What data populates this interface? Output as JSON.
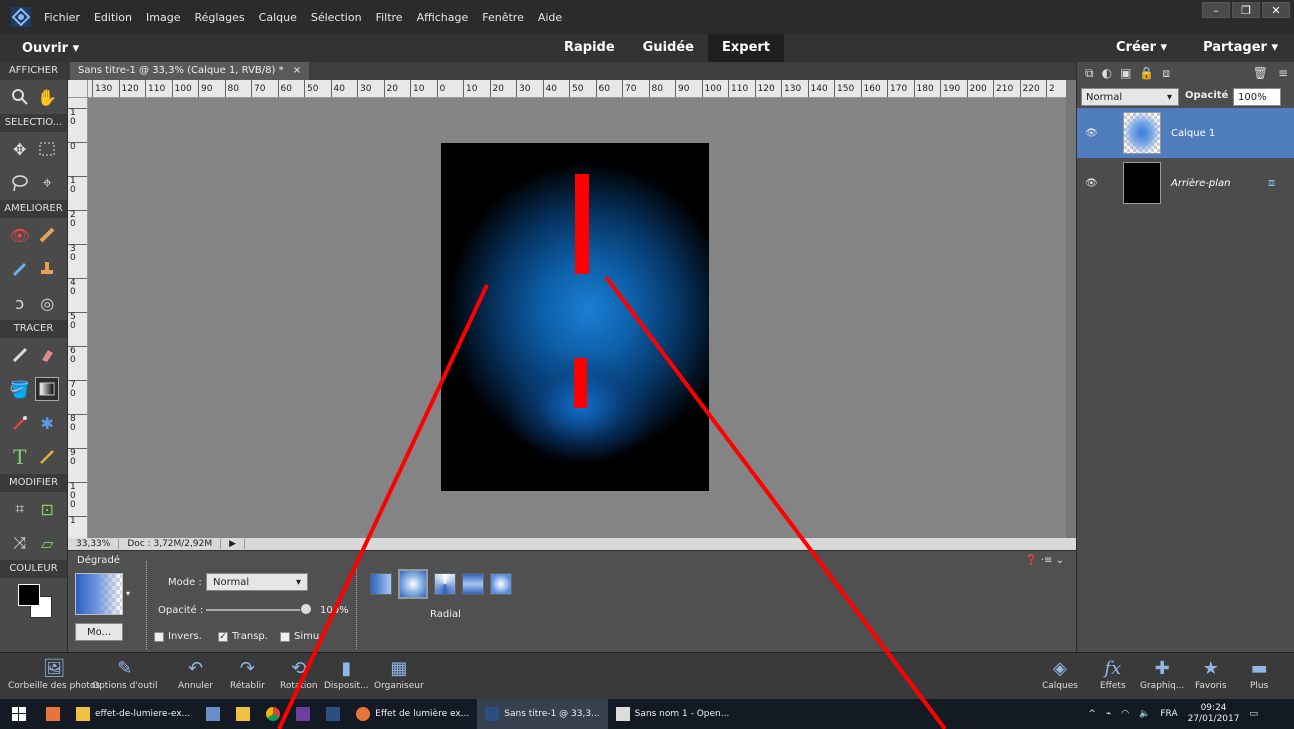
{
  "menu": {
    "items": [
      "Fichier",
      "Edition",
      "Image",
      "Réglages",
      "Calque",
      "Sélection",
      "Filtre",
      "Affichage",
      "Fenêtre",
      "Aide"
    ]
  },
  "window_controls": {
    "minimize": "–",
    "restore": "❐",
    "close": "✕"
  },
  "modebar": {
    "open_label": "Ouvrir ▾",
    "modes": [
      "Rapide",
      "Guidée",
      "Expert"
    ],
    "active_mode": "Expert",
    "create_label": "Créer ▾",
    "share_label": "Partager ▾"
  },
  "toolbox": {
    "sections": [
      "AFFICHER",
      "SELECTIO...",
      "AMELIORER",
      "TRACER",
      "MODIFIER",
      "COULEUR"
    ]
  },
  "document": {
    "tab_title": "Sans titre-1 @ 33,3% (Calque 1, RVB/8) *",
    "tab_close": "×",
    "h_ruler_ticks": [
      "130",
      "120",
      "110",
      "100",
      "90",
      "80",
      "70",
      "60",
      "50",
      "40",
      "30",
      "20",
      "10",
      "0",
      "10",
      "20",
      "30",
      "40",
      "50",
      "60",
      "70",
      "80",
      "90",
      "100",
      "110",
      "120",
      "130",
      "140",
      "150",
      "160",
      "170",
      "180",
      "190",
      "200",
      "210",
      "220",
      "2"
    ],
    "v_ruler_ticks": [
      "1\n0",
      "0",
      "1\n0",
      "2\n0",
      "3\n0",
      "4\n0",
      "5\n0",
      "6\n0",
      "7\n0",
      "8\n0",
      "9\n0",
      "1\n0\n0",
      "1"
    ]
  },
  "status": {
    "zoom": "33,33%",
    "doc_size": "Doc : 3,72M/2,92M",
    "arrow": "▶"
  },
  "options": {
    "title": "Dégradé",
    "modify_label": "Mo...",
    "mode_label": "Mode :",
    "mode_value": "Normal",
    "opacity_label": "Opacité :",
    "opacity_value": "100%",
    "opacity_fraction": 1.0,
    "checkboxes": [
      {
        "label": "Invers.",
        "checked": false
      },
      {
        "label": "Transp.",
        "checked": true
      },
      {
        "label": "Simu",
        "checked": false
      }
    ],
    "gradient_type_label": "Radial",
    "header_icons": "❓ ·≡ ⌄"
  },
  "layers_panel": {
    "blend_mode": "Normal",
    "opacity_label": "Opacité :",
    "opacity_value": "100%",
    "layers": [
      {
        "name": "Calque 1",
        "active": true
      },
      {
        "name": "Arrière-plan",
        "active": false
      }
    ]
  },
  "panelbar": {
    "left": [
      "Corbeille des photos",
      "Options d'outil",
      "Annuler",
      "Rétablir",
      "Rotation",
      "Disposit...",
      "Organiseur"
    ],
    "right": [
      "Calques",
      "Effets",
      "Graphiq...",
      "Favoris",
      "Plus"
    ]
  },
  "taskbar": {
    "apps": [
      {
        "label": "effet-de-lumiere-ex...",
        "active": false
      },
      {
        "label": "Effet de lumière ex...",
        "active": false
      },
      {
        "label": "Sans titre-1 @ 33,3...",
        "active": true
      },
      {
        "label": "Sans nom 1 - Open...",
        "active": false
      }
    ],
    "language": "FRA",
    "time": "09:24",
    "date": "27/01/2017"
  },
  "colors": {
    "accent_active_layer": "#4f7dbd",
    "annotation_red": "#ff0000",
    "canvas_gray": "#848484"
  }
}
